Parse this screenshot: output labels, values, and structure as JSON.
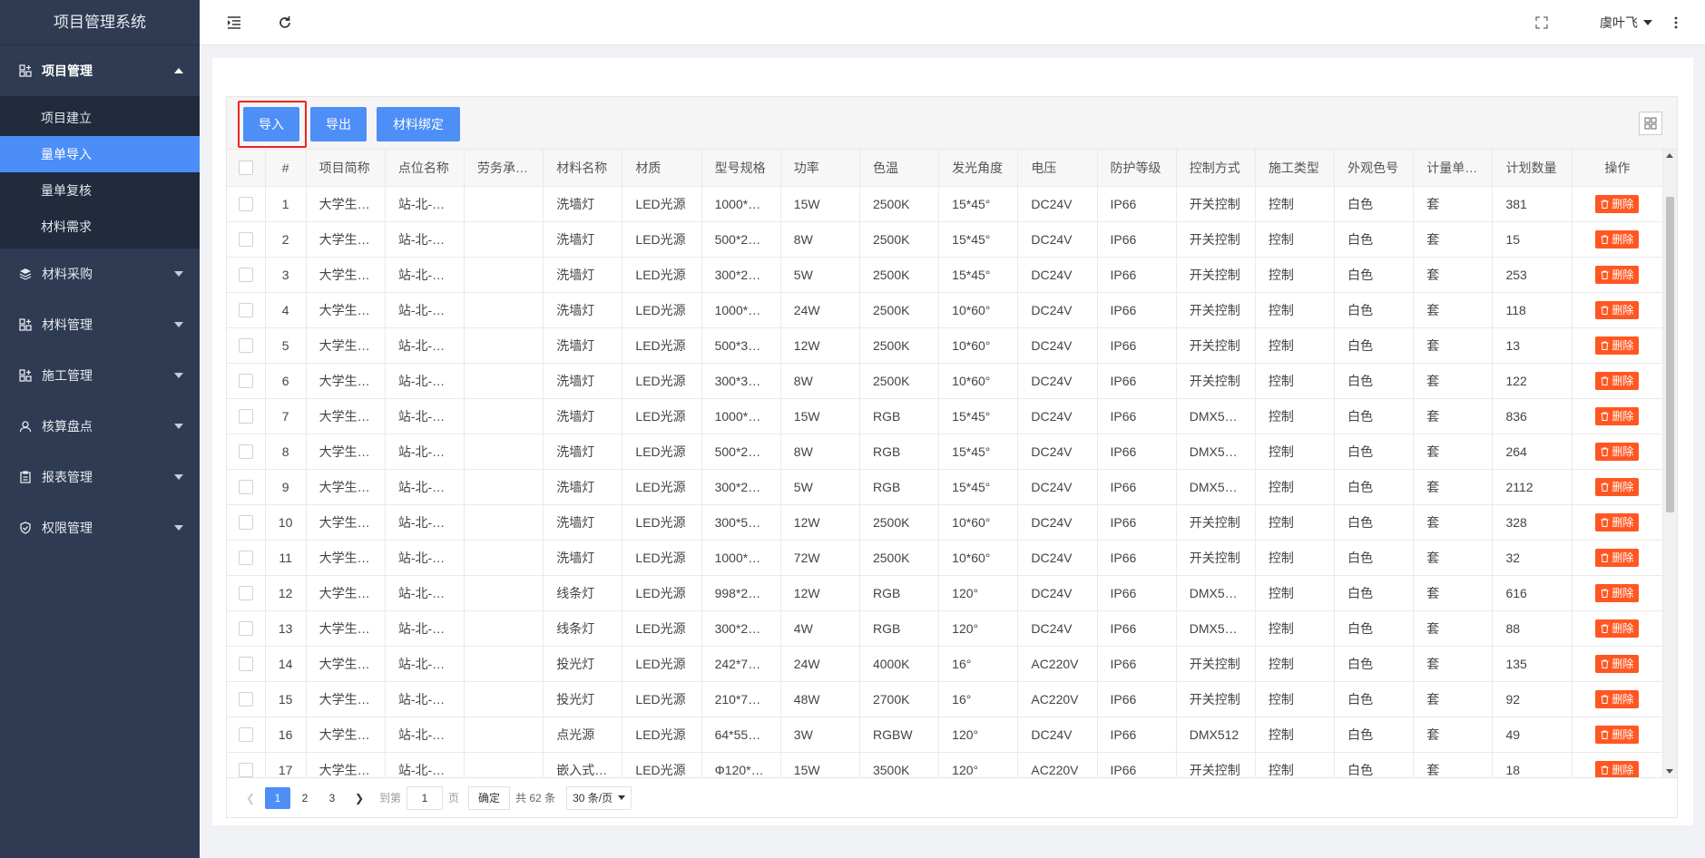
{
  "app": {
    "title": "项目管理系统"
  },
  "sidebar": {
    "groups": [
      {
        "label": "项目管理",
        "icon": "apps-icon",
        "open": true,
        "items": [
          {
            "label": "项目建立"
          },
          {
            "label": "量单导入",
            "active": true
          },
          {
            "label": "量单复核"
          },
          {
            "label": "材料需求"
          }
        ]
      },
      {
        "label": "材料采购",
        "icon": "layers-icon"
      },
      {
        "label": "材料管理",
        "icon": "apps-icon"
      },
      {
        "label": "施工管理",
        "icon": "apps-icon"
      },
      {
        "label": "核算盘点",
        "icon": "user-icon"
      },
      {
        "label": "报表管理",
        "icon": "clipboard-icon"
      },
      {
        "label": "权限管理",
        "icon": "shield-icon"
      }
    ]
  },
  "header": {
    "user": "虞叶飞"
  },
  "toolbar": {
    "import_label": "导入",
    "export_label": "导出",
    "bind_label": "材料绑定"
  },
  "table": {
    "columns": [
      "#",
      "项目简称",
      "点位名称",
      "劳务承…",
      "材料名称",
      "材质",
      "型号规格",
      "功率",
      "色温",
      "发光角度",
      "电压",
      "防护等级",
      "控制方式",
      "施工类型",
      "外观色号",
      "计量单…",
      "计划数量",
      "操作"
    ],
    "delete_label": "删除",
    "rows": [
      [
        "1",
        "大学生…",
        "站-北-…",
        "",
        "洗墙灯",
        "LED光源",
        "1000*…",
        "15W",
        "2500K",
        "15*45°",
        "DC24V",
        "IP66",
        "开关控制",
        "控制",
        "白色",
        "套",
        "381"
      ],
      [
        "2",
        "大学生…",
        "站-北-…",
        "",
        "洗墙灯",
        "LED光源",
        "500*2…",
        "8W",
        "2500K",
        "15*45°",
        "DC24V",
        "IP66",
        "开关控制",
        "控制",
        "白色",
        "套",
        "15"
      ],
      [
        "3",
        "大学生…",
        "站-北-…",
        "",
        "洗墙灯",
        "LED光源",
        "300*2…",
        "5W",
        "2500K",
        "15*45°",
        "DC24V",
        "IP66",
        "开关控制",
        "控制",
        "白色",
        "套",
        "253"
      ],
      [
        "4",
        "大学生…",
        "站-北-…",
        "",
        "洗墙灯",
        "LED光源",
        "1000*…",
        "24W",
        "2500K",
        "10*60°",
        "DC24V",
        "IP66",
        "开关控制",
        "控制",
        "白色",
        "套",
        "118"
      ],
      [
        "5",
        "大学生…",
        "站-北-…",
        "",
        "洗墙灯",
        "LED光源",
        "500*3…",
        "12W",
        "2500K",
        "10*60°",
        "DC24V",
        "IP66",
        "开关控制",
        "控制",
        "白色",
        "套",
        "13"
      ],
      [
        "6",
        "大学生…",
        "站-北-…",
        "",
        "洗墙灯",
        "LED光源",
        "300*3…",
        "8W",
        "2500K",
        "10*60°",
        "DC24V",
        "IP66",
        "开关控制",
        "控制",
        "白色",
        "套",
        "122"
      ],
      [
        "7",
        "大学生…",
        "站-北-…",
        "",
        "洗墙灯",
        "LED光源",
        "1000*…",
        "15W",
        "RGB",
        "15*45°",
        "DC24V",
        "IP66",
        "DMX5…",
        "控制",
        "白色",
        "套",
        "836"
      ],
      [
        "8",
        "大学生…",
        "站-北-…",
        "",
        "洗墙灯",
        "LED光源",
        "500*2…",
        "8W",
        "RGB",
        "15*45°",
        "DC24V",
        "IP66",
        "DMX5…",
        "控制",
        "白色",
        "套",
        "264"
      ],
      [
        "9",
        "大学生…",
        "站-北-…",
        "",
        "洗墙灯",
        "LED光源",
        "300*2…",
        "5W",
        "RGB",
        "15*45°",
        "DC24V",
        "IP66",
        "DMX5…",
        "控制",
        "白色",
        "套",
        "2112"
      ],
      [
        "10",
        "大学生…",
        "站-北-…",
        "",
        "洗墙灯",
        "LED光源",
        "300*5…",
        "12W",
        "2500K",
        "10*60°",
        "DC24V",
        "IP66",
        "开关控制",
        "控制",
        "白色",
        "套",
        "328"
      ],
      [
        "11",
        "大学生…",
        "站-北-…",
        "",
        "洗墙灯",
        "LED光源",
        "1000*…",
        "72W",
        "2500K",
        "10*60°",
        "DC24V",
        "IP66",
        "开关控制",
        "控制",
        "白色",
        "套",
        "32"
      ],
      [
        "12",
        "大学生…",
        "站-北-…",
        "",
        "线条灯",
        "LED光源",
        "998*2…",
        "12W",
        "RGB",
        "120°",
        "DC24V",
        "IP66",
        "DMX5…",
        "控制",
        "白色",
        "套",
        "616"
      ],
      [
        "13",
        "大学生…",
        "站-北-…",
        "",
        "线条灯",
        "LED光源",
        "300*2…",
        "4W",
        "RGB",
        "120°",
        "DC24V",
        "IP66",
        "DMX5…",
        "控制",
        "白色",
        "套",
        "88"
      ],
      [
        "14",
        "大学生…",
        "站-北-…",
        "",
        "投光灯",
        "LED光源",
        "242*7…",
        "24W",
        "4000K",
        "16°",
        "AC220V",
        "IP66",
        "开关控制",
        "控制",
        "白色",
        "套",
        "135"
      ],
      [
        "15",
        "大学生…",
        "站-北-…",
        "",
        "投光灯",
        "LED光源",
        "210*7…",
        "48W",
        "2700K",
        "16°",
        "AC220V",
        "IP66",
        "开关控制",
        "控制",
        "白色",
        "套",
        "92"
      ],
      [
        "16",
        "大学生…",
        "站-北-…",
        "",
        "点光源",
        "LED光源",
        "64*55…",
        "3W",
        "RGBW",
        "120°",
        "DC24V",
        "IP66",
        "DMX512",
        "控制",
        "白色",
        "套",
        "49"
      ],
      [
        "17",
        "大学生…",
        "站-北-…",
        "",
        "嵌入式…",
        "LED光源",
        "Φ120*…",
        "15W",
        "3500K",
        "120°",
        "AC220V",
        "IP66",
        "开关控制",
        "控制",
        "白色",
        "套",
        "18"
      ]
    ]
  },
  "pager": {
    "pages": [
      "1",
      "2",
      "3"
    ],
    "current": "1",
    "goto_prefix": "到第",
    "goto_value": "1",
    "goto_suffix": "页",
    "confirm": "确定",
    "total": "共 62 条",
    "page_size": "30 条/页"
  },
  "colors": {
    "sidebar_bg": "#2f3b52",
    "accent": "#4e8ef7",
    "danger": "#ff5722"
  }
}
